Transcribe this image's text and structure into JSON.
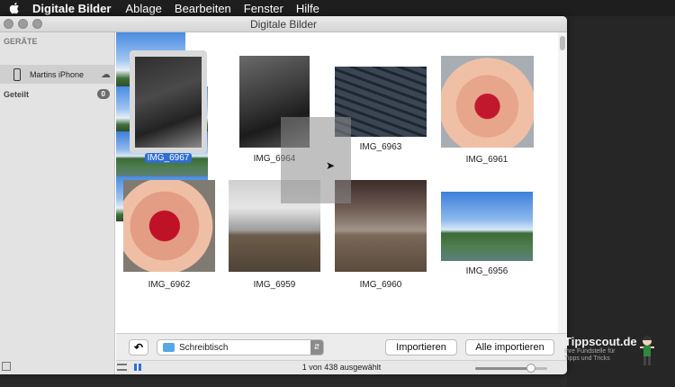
{
  "menubar": {
    "app_name": "Digitale Bilder",
    "items": [
      "Ablage",
      "Bearbeiten",
      "Fenster",
      "Hilfe"
    ]
  },
  "window": {
    "title": "Digitale Bilder"
  },
  "sidebar": {
    "section_devices": "GERÄTE",
    "device_name": "Martins iPhone",
    "shared_label": "Geteilt",
    "shared_count": "0"
  },
  "thumbnails": [
    {
      "caption": "IMG_6967",
      "selected": true
    },
    {
      "caption": "IMG_6964"
    },
    {
      "caption": "IMG_6963"
    },
    {
      "caption": "IMG_6961"
    },
    {
      "caption": "IMG_6962"
    },
    {
      "caption": "IMG_6959"
    },
    {
      "caption": "IMG_6960"
    },
    {
      "caption": "IMG_6956"
    }
  ],
  "import_bar": {
    "destination": "Schreibtisch",
    "import_label": "Importieren",
    "import_all_label": "Alle importieren"
  },
  "status": {
    "selection_text": "1 von 438 ausgewählt",
    "zoom_level": 0.78
  },
  "branding": {
    "name": "Tippscout.de",
    "tagline_1": "Ihre Fundstelle für",
    "tagline_2": "Tipps und Tricks"
  },
  "colors": {
    "selection_blue": "#2f6fd3",
    "folder_blue": "#58a6e6"
  }
}
